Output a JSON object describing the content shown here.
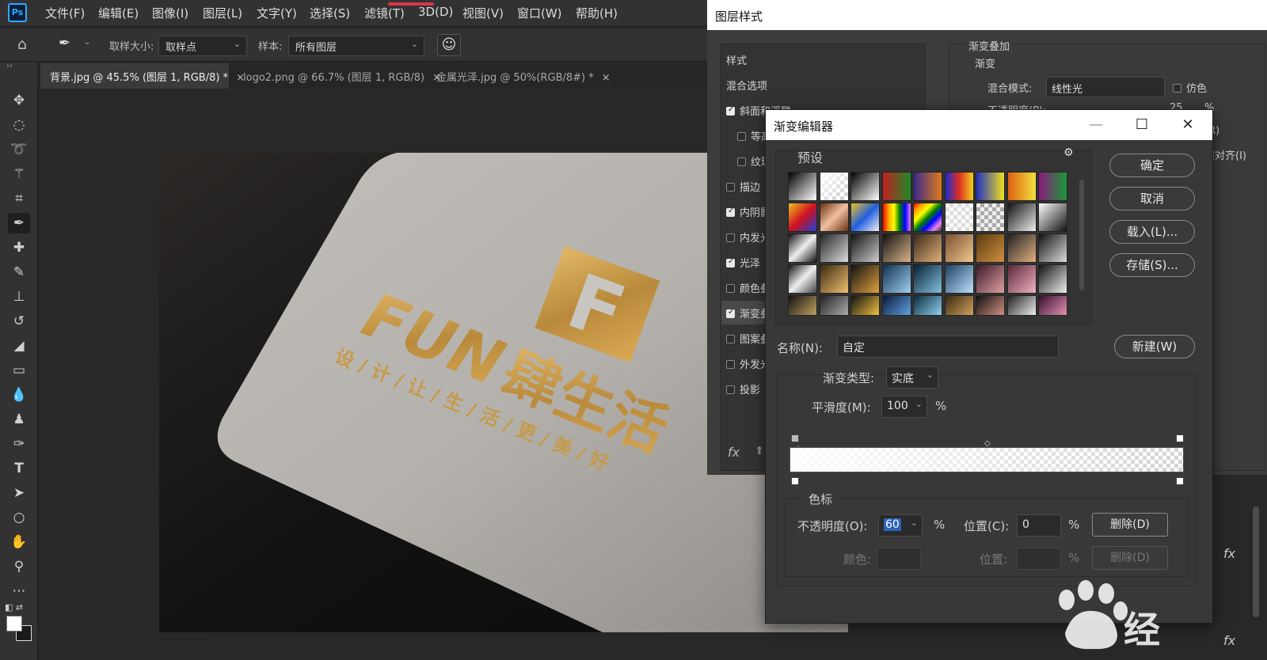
{
  "app": {
    "logo": "Ps"
  },
  "menu": [
    "文件(F)",
    "编辑(E)",
    "图像(I)",
    "图层(L)",
    "文字(Y)",
    "选择(S)",
    "滤镜(T)",
    "3D(D)",
    "视图(V)",
    "窗口(W)",
    "帮助(H)"
  ],
  "options": {
    "sample_size_label": "取样大小:",
    "sample_size_value": "取样点",
    "sample_label": "样本:",
    "sample_value": "所有图层"
  },
  "tabs": [
    {
      "label": "背景.jpg @ 45.5% (图层 1, RGB/8) *",
      "active": true
    },
    {
      "label": "logo2.png @ 66.7% (图层 1, RGB/8)",
      "active": false
    },
    {
      "label": "金属光泽.jpg @ 50%(RGB/8#) *",
      "active": false
    }
  ],
  "tab_close": "×",
  "artwork": {
    "slogan_latin": "FUN",
    "slogan_cjk": "肆生活",
    "tagline": "设 / 计 / 让 / 生 / 活 / 更 / 美 / 好",
    "logo_letter": "F"
  },
  "layer_style": {
    "title": "图层样式",
    "items": [
      {
        "label": "样式",
        "checkbox": null
      },
      {
        "label": "混合选项",
        "checkbox": null
      },
      {
        "label": "斜面和浮雕",
        "checkbox": true
      },
      {
        "label": "等高",
        "checkbox": false,
        "indent": true
      },
      {
        "label": "纹理",
        "checkbox": false,
        "indent": true
      },
      {
        "label": "描边",
        "checkbox": false
      },
      {
        "label": "内阴影",
        "checkbox": true
      },
      {
        "label": "内发光",
        "checkbox": false
      },
      {
        "label": "光泽",
        "checkbox": true
      },
      {
        "label": "颜色叠",
        "checkbox": false
      },
      {
        "label": "渐变叠",
        "checkbox": true,
        "selected": true
      },
      {
        "label": "图案叠",
        "checkbox": false
      },
      {
        "label": "外发光",
        "checkbox": false
      },
      {
        "label": "投影",
        "checkbox": false
      }
    ],
    "fx_label": "fx",
    "right": {
      "section": "渐变叠加",
      "subsection": "渐变",
      "blend_mode_label": "混合模式:",
      "blend_mode_value": "线性光",
      "dither_label": "仿色",
      "opacity_label": "不透明度(P):",
      "opacity_value": "25",
      "percent": "%",
      "reverse_label": "(R)",
      "align_label": "层对齐(I)"
    }
  },
  "gradient_editor": {
    "title": "渐变编辑器",
    "presets_label": "预设",
    "buttons": {
      "ok": "确定",
      "cancel": "取消",
      "load": "载入(L)...",
      "save": "存储(S)...",
      "new": "新建(W)"
    },
    "name_label": "名称(N):",
    "name_value": "自定",
    "type_label": "渐变类型:",
    "type_value": "实底",
    "smooth_label": "平滑度(M):",
    "smooth_value": "100",
    "percent": "%",
    "stops_label": "色标",
    "opacity_label": "不透明度(O):",
    "opacity_value": "60",
    "location_label": "位置(C):",
    "location_value": "0",
    "delete_label": "删除(D)",
    "color_label": "颜色:",
    "location2_label": "位置:",
    "delete2_label": "删除(D)"
  },
  "watermark": {
    "text": "经"
  }
}
